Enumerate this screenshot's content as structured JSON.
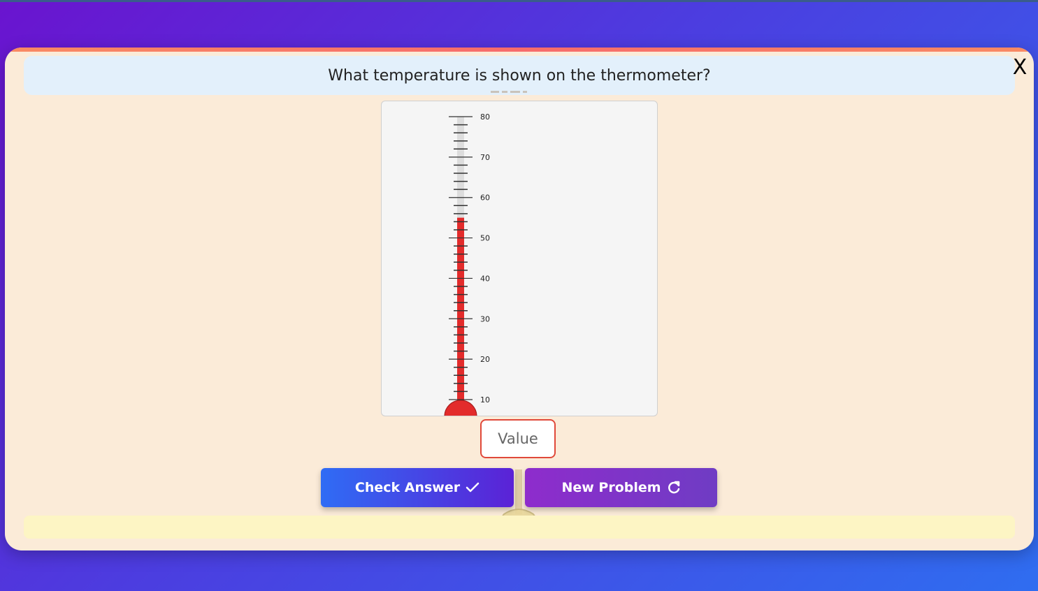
{
  "question": "What temperature is shown on the thermometer?",
  "close_label": "X",
  "thermometer": {
    "min": 10,
    "max": 80,
    "current_value": 55,
    "major_step": 10,
    "minor_step": 2,
    "tick_labels": [
      "80",
      "70",
      "60",
      "50",
      "40",
      "30",
      "20",
      "10"
    ],
    "mercury_color": "#e32b2b"
  },
  "answer_input": {
    "value": "",
    "placeholder": "Value"
  },
  "buttons": {
    "check_label": "Check Answer",
    "check_icon": "checkmark-icon",
    "new_label": "New Problem",
    "new_icon": "refresh-icon"
  },
  "feedback": {
    "text": ""
  },
  "colors": {
    "card_bg": "#fbebd8",
    "question_bg": "#e3f0fb",
    "feedback_bg": "#fdf5c4",
    "input_border": "#e0493a"
  }
}
